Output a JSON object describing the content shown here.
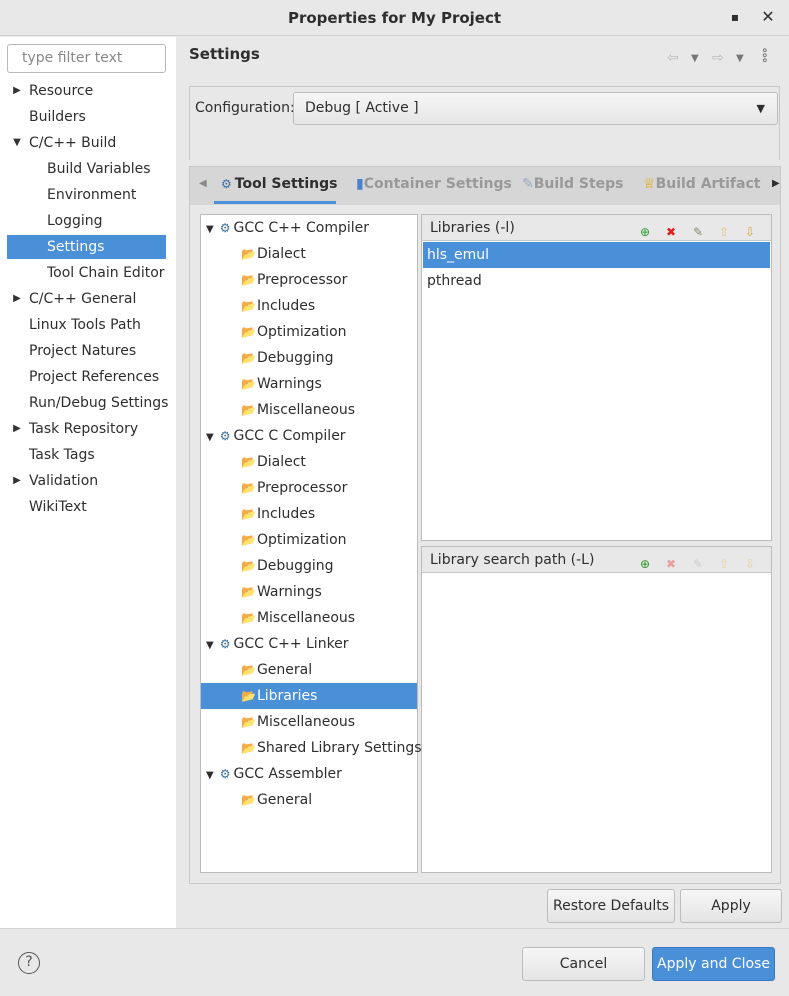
{
  "window": {
    "title": "Properties for My Project",
    "minimize": "▪",
    "close": "✕"
  },
  "filter": {
    "placeholder": "type filter text"
  },
  "nav": [
    {
      "label": "Resource",
      "expander": "collapsed",
      "indent": 0
    },
    {
      "label": "Builders",
      "expander": "none",
      "indent": 0
    },
    {
      "label": "C/C++ Build",
      "expander": "expanded",
      "indent": 0
    },
    {
      "label": "Build Variables",
      "expander": "none",
      "indent": 1
    },
    {
      "label": "Environment",
      "expander": "none",
      "indent": 1
    },
    {
      "label": "Logging",
      "expander": "none",
      "indent": 1
    },
    {
      "label": "Settings",
      "expander": "none",
      "indent": 1,
      "selected": true
    },
    {
      "label": "Tool Chain Editor",
      "expander": "none",
      "indent": 1
    },
    {
      "label": "C/C++ General",
      "expander": "collapsed",
      "indent": 0
    },
    {
      "label": "Linux Tools Path",
      "expander": "none",
      "indent": 0
    },
    {
      "label": "Project Natures",
      "expander": "none",
      "indent": 0
    },
    {
      "label": "Project References",
      "expander": "none",
      "indent": 0
    },
    {
      "label": "Run/Debug Settings",
      "expander": "none",
      "indent": 0
    },
    {
      "label": "Task Repository",
      "expander": "collapsed",
      "indent": 0
    },
    {
      "label": "Task Tags",
      "expander": "none",
      "indent": 0
    },
    {
      "label": "Validation",
      "expander": "collapsed",
      "indent": 0
    },
    {
      "label": "WikiText",
      "expander": "none",
      "indent": 0
    }
  ],
  "page": {
    "title": "Settings",
    "config_label": "Configuration:",
    "config_value": "Debug  [ Active ]"
  },
  "tabs": [
    "Tool Settings",
    "Container Settings",
    "Build Steps",
    "Build Artifact"
  ],
  "tool_tree": [
    {
      "label": "GCC C++ Compiler",
      "type": "tool"
    },
    {
      "label": "Dialect",
      "type": "opt"
    },
    {
      "label": "Preprocessor",
      "type": "opt"
    },
    {
      "label": "Includes",
      "type": "opt"
    },
    {
      "label": "Optimization",
      "type": "opt"
    },
    {
      "label": "Debugging",
      "type": "opt"
    },
    {
      "label": "Warnings",
      "type": "opt"
    },
    {
      "label": "Miscellaneous",
      "type": "opt"
    },
    {
      "label": "GCC C Compiler",
      "type": "tool"
    },
    {
      "label": "Dialect",
      "type": "opt"
    },
    {
      "label": "Preprocessor",
      "type": "opt"
    },
    {
      "label": "Includes",
      "type": "opt"
    },
    {
      "label": "Optimization",
      "type": "opt"
    },
    {
      "label": "Debugging",
      "type": "opt"
    },
    {
      "label": "Warnings",
      "type": "opt"
    },
    {
      "label": "Miscellaneous",
      "type": "opt"
    },
    {
      "label": "GCC C++ Linker",
      "type": "tool"
    },
    {
      "label": "General",
      "type": "opt"
    },
    {
      "label": "Libraries",
      "type": "opt",
      "selected": true
    },
    {
      "label": "Miscellaneous",
      "type": "opt"
    },
    {
      "label": "Shared Library Settings",
      "type": "opt"
    },
    {
      "label": "GCC Assembler",
      "type": "tool"
    },
    {
      "label": "General",
      "type": "opt"
    }
  ],
  "libraries": {
    "title": "Libraries (-l)",
    "items": [
      "hls_emul",
      "pthread"
    ]
  },
  "library_paths": {
    "title": "Library search path (-L)",
    "items": []
  },
  "buttons": {
    "restore": "Restore Defaults",
    "apply": "Apply",
    "cancel": "Cancel",
    "apply_close": "Apply and Close",
    "help": "?"
  }
}
